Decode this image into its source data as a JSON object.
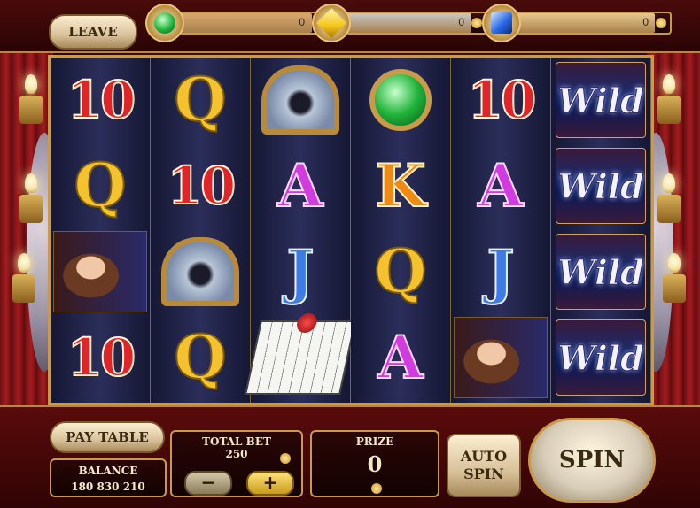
{
  "header": {
    "leave_label": "LEAVE",
    "meters": [
      {
        "gem": "green-gem-icon",
        "value": "0",
        "fill_fraction": 0.9,
        "fill_color": "#d9a870"
      },
      {
        "gem": "yellow-diamond-icon",
        "value": "0",
        "fill_fraction": 0.9,
        "fill_color": "#c8c8c8"
      },
      {
        "gem": "blue-sapphire-icon",
        "value": "0",
        "fill_fraction": 0.9,
        "fill_color": "#e8c890"
      }
    ]
  },
  "reels": [
    [
      "10",
      "Q",
      "portrait",
      "10"
    ],
    [
      "Q",
      "10",
      "mirror",
      "Q"
    ],
    [
      "mirror",
      "A",
      "J",
      "piano"
    ],
    [
      "gem",
      "K",
      "Q",
      "A"
    ],
    [
      "10",
      "A",
      "J",
      "portrait"
    ],
    [
      "Wild",
      "Wild",
      "Wild",
      "Wild"
    ]
  ],
  "controls": {
    "paytable_label": "PAY TABLE",
    "balance_label": "BALANCE",
    "balance_value": "180 830 210",
    "total_bet_label": "TOTAL BET",
    "total_bet_value": "250",
    "minus_label": "−",
    "plus_label": "+",
    "prize_label": "PRIZE",
    "prize_value": "0",
    "autospin_line1": "AUTO",
    "autospin_line2": "SPIN",
    "spin_label": "SPIN"
  }
}
